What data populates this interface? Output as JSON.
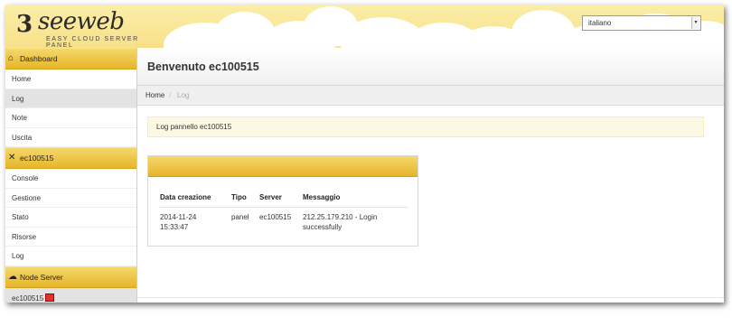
{
  "header": {
    "logo_text": "seeweb",
    "logo_mark": "3",
    "logo_subtitle": "EASY CLOUD SERVER PANEL",
    "language_select": {
      "value": "italiano"
    }
  },
  "sidebar": {
    "sections": [
      {
        "label": "Dashboard",
        "icon": "home-icon",
        "items": [
          "Home",
          "Log",
          "Note",
          "Uscita"
        ]
      },
      {
        "label": "ec100515",
        "icon": "tools-icon",
        "items": [
          "Console",
          "Gestione",
          "Stato",
          "Risorse",
          "Log"
        ]
      },
      {
        "label": "Node Server",
        "icon": "cloud-icon",
        "items": [
          "ec100515"
        ]
      }
    ],
    "active_item": "Log"
  },
  "main": {
    "title": "Benvenuto ec100515",
    "breadcrumb": {
      "home": "Home",
      "separator": "/",
      "current": "Log"
    },
    "alert": "Log pannello ec100515",
    "table": {
      "headers": [
        "Data creazione",
        "Tipo",
        "Server",
        "Messaggio"
      ],
      "rows": [
        {
          "date_line1": "2014-11-24",
          "date_line2": "15:33:47",
          "tipo": "panel",
          "server": "ec100515",
          "msg_line1": "212.25.179.210 - Login",
          "msg_line2": "successfully"
        }
      ]
    }
  },
  "colors": {
    "accent": "#e7b52a",
    "header_bg": "#f8e089",
    "alert_bg": "#fcf8e3"
  }
}
